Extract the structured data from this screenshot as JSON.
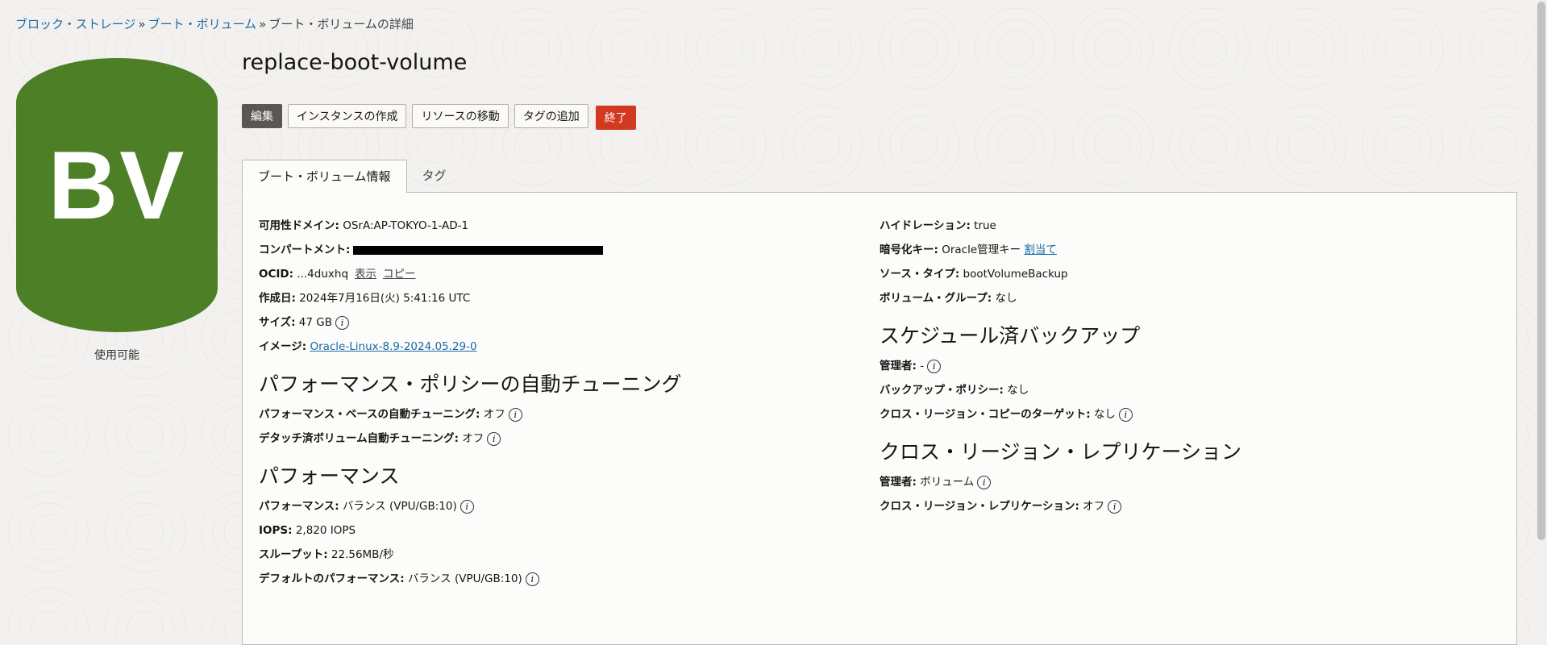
{
  "breadcrumb": {
    "items": [
      {
        "label": "ブロック・ストレージ",
        "link": true
      },
      {
        "label": "ブート・ボリューム",
        "link": true
      },
      {
        "label": "ブート・ボリュームの詳細",
        "link": false
      }
    ],
    "separator": "»"
  },
  "badge": {
    "text": "BV",
    "status": "使用可能",
    "color": "#4d7f26"
  },
  "title": "replace-boot-volume",
  "actions": {
    "edit": "編集",
    "create_instance": "インスタンスの作成",
    "move_resource": "リソースの移動",
    "add_tags": "タグの追加",
    "terminate": "終了"
  },
  "tabs": [
    {
      "label": "ブート・ボリューム情報",
      "active": true
    },
    {
      "label": "タグ",
      "active": false
    }
  ],
  "info_icon": "i",
  "details": {
    "availability_domain": {
      "label": "可用性ドメイン:",
      "value": "OSrA:AP-TOKYO-1-AD-1"
    },
    "compartment": {
      "label": "コンパートメント:"
    },
    "ocid": {
      "label": "OCID:",
      "value": "...4duxhq",
      "show": "表示",
      "copy": "コピー"
    },
    "created": {
      "label": "作成日:",
      "value": "2024年7月16日(火) 5:41:16 UTC"
    },
    "size": {
      "label": "サイズ:",
      "value": "47 GB"
    },
    "image": {
      "label": "イメージ:",
      "value": "Oracle-Linux-8.9-2024.05.29-0"
    }
  },
  "auto_tune": {
    "title": "パフォーマンス・ポリシーの自動チューニング",
    "perf_based": {
      "label": "パフォーマンス・ベースの自動チューニング:",
      "value": "オフ"
    },
    "detached": {
      "label": "デタッチ済ボリューム自動チューニング:",
      "value": "オフ"
    }
  },
  "performance": {
    "title": "パフォーマンス",
    "perf": {
      "label": "パフォーマンス:",
      "value": "バランス (VPU/GB:10)"
    },
    "iops": {
      "label": "IOPS:",
      "value": "2,820 IOPS"
    },
    "throughput": {
      "label": "スループット:",
      "value": "22.56MB/秒"
    },
    "default_perf": {
      "label": "デフォルトのパフォーマンス:",
      "value": "バランス (VPU/GB:10)"
    }
  },
  "right": {
    "hydration": {
      "label": "ハイドレーション:",
      "value": "true"
    },
    "encryption": {
      "label": "暗号化キー:",
      "value": "Oracle管理キー",
      "assign": "割当て"
    },
    "source_type": {
      "label": "ソース・タイプ:",
      "value": "bootVolumeBackup"
    },
    "volume_group": {
      "label": "ボリューム・グループ:",
      "value": "なし"
    }
  },
  "scheduled_backup": {
    "title": "スケジュール済バックアップ",
    "manager": {
      "label": "管理者:",
      "value": "-"
    },
    "policy": {
      "label": "バックアップ・ポリシー:",
      "value": "なし"
    },
    "cross_region_target": {
      "label": "クロス・リージョン・コピーのターゲット:",
      "value": "なし"
    }
  },
  "replication": {
    "title": "クロス・リージョン・レプリケーション",
    "manager": {
      "label": "管理者:",
      "value": "ボリューム"
    },
    "replication": {
      "label": "クロス・リージョン・レプリケーション:",
      "value": "オフ"
    }
  }
}
